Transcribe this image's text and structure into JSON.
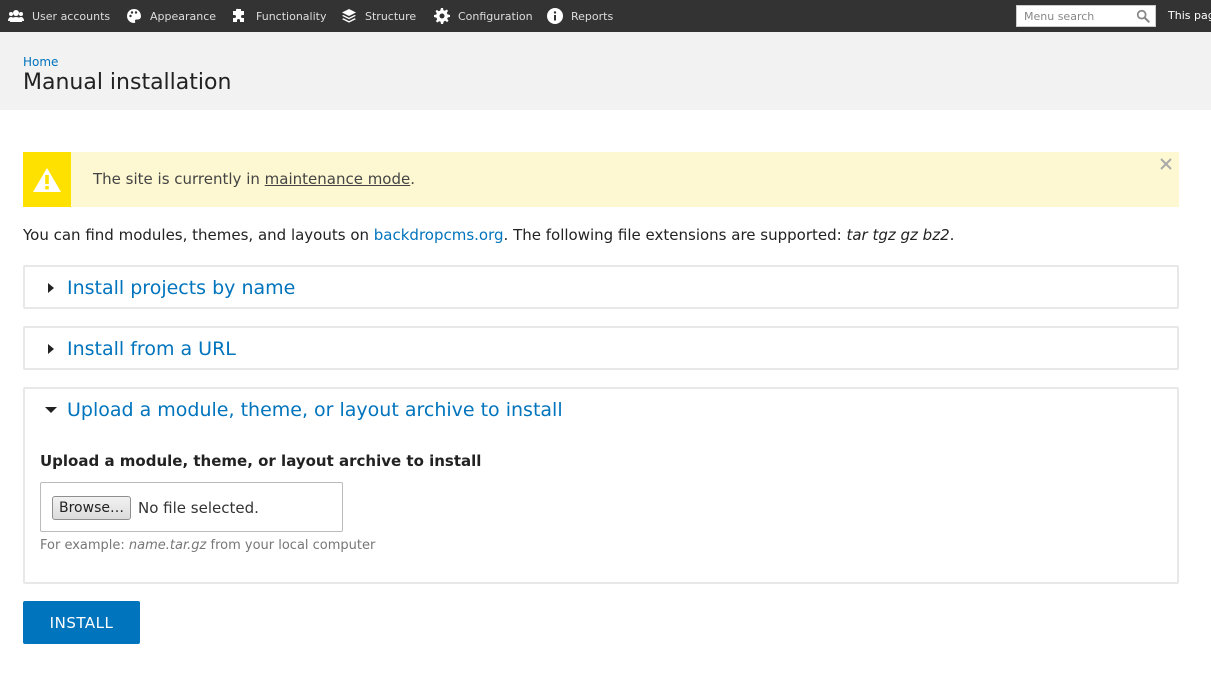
{
  "toolbar": {
    "items": [
      {
        "label": "User accounts",
        "icon": "users-icon"
      },
      {
        "label": "Appearance",
        "icon": "palette-icon"
      },
      {
        "label": "Functionality",
        "icon": "puzzle-icon"
      },
      {
        "label": "Structure",
        "icon": "layers-icon"
      },
      {
        "label": "Configuration",
        "icon": "gear-icon"
      },
      {
        "label": "Reports",
        "icon": "info-icon"
      }
    ],
    "search_placeholder": "Menu search",
    "page_link": "This pag"
  },
  "header": {
    "breadcrumb": "Home",
    "title": "Manual installation"
  },
  "message": {
    "text_before": "The site is currently in ",
    "link": "maintenance mode",
    "text_after": ".",
    "color": "#fdf8d1",
    "icon_color": "#ffe100"
  },
  "intro": {
    "text_before": "You can find modules, themes, and layouts on ",
    "link": "backdropcms.org",
    "text_middle": ". The following file extensions are supported: ",
    "extensions": "tar tgz gz bz2",
    "text_after": "."
  },
  "fieldsets": [
    {
      "legend": "Install projects by name",
      "expanded": false
    },
    {
      "legend": "Install from a URL",
      "expanded": false
    },
    {
      "legend": "Upload a module, theme, or layout archive to install",
      "expanded": true
    }
  ],
  "upload": {
    "label": "Upload a module, theme, or layout archive to install",
    "browse_label": "Browse…",
    "no_file": "No file selected.",
    "desc_before": "For example: ",
    "desc_example": "name.tar.gz",
    "desc_after": " from your local computer"
  },
  "install_button": "INSTALL",
  "accent": "#0074bd"
}
